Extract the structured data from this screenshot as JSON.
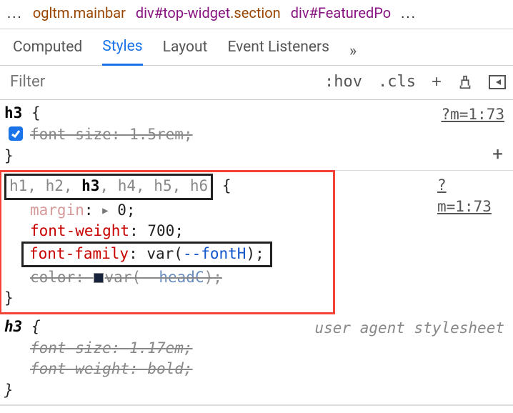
{
  "breadcrumb": {
    "ellipsis_left": "...",
    "item1": {
      "cls": "ogltm.mainbar"
    },
    "item2": {
      "tag": "div",
      "id": "top-widget",
      "cls": "section"
    },
    "item3": {
      "tag": "div",
      "id": "FeaturedPo"
    },
    "ellipsis_right": "..."
  },
  "tabs": {
    "computed": "Computed",
    "styles": "Styles",
    "layout": "Layout",
    "listeners": "Event Listeners",
    "more": "»"
  },
  "filter": {
    "placeholder": "Filter",
    "hov": ":hov",
    "cls": ".cls",
    "plus": "+"
  },
  "rules": [
    {
      "source": "?m=1:73",
      "selector_pre": "",
      "selector_match": "h3",
      "selector_post": "",
      "brace_open": " {",
      "decls": [
        {
          "prop": "font-size",
          "val": "1.5rem",
          "overridden": true,
          "checked": true
        }
      ],
      "brace_close": "}",
      "show_add": true
    },
    {
      "source": "?m=1:73",
      "highlight": true,
      "selector_boxed": true,
      "selector_pre": "h1, h2, ",
      "selector_match": "h3",
      "selector_post": ", h4, h5, h6",
      "brace_open": " {",
      "decls": [
        {
          "prop": "margin",
          "val": "0",
          "shorthand": true,
          "fade": true
        },
        {
          "prop": "font-weight",
          "val": "700"
        },
        {
          "prop": "font-family",
          "val_raw": "var(",
          "varref": "--fontH",
          "val_close": ")",
          "boxed": true
        },
        {
          "prop": "color",
          "swatch": true,
          "val_raw": "var(",
          "varref": "--headC",
          "val_close": ")",
          "overridden": true
        }
      ],
      "brace_close": "}"
    },
    {
      "source_label": "user agent stylesheet",
      "ua": true,
      "selector_pre": "",
      "selector_match": "h3",
      "selector_post": "",
      "brace_open": " {",
      "decls": [
        {
          "prop": "font-size",
          "val": "1.17em",
          "overridden": true
        },
        {
          "prop": "font-weight",
          "val": "bold",
          "overridden": true
        }
      ],
      "brace_close": "}"
    }
  ]
}
